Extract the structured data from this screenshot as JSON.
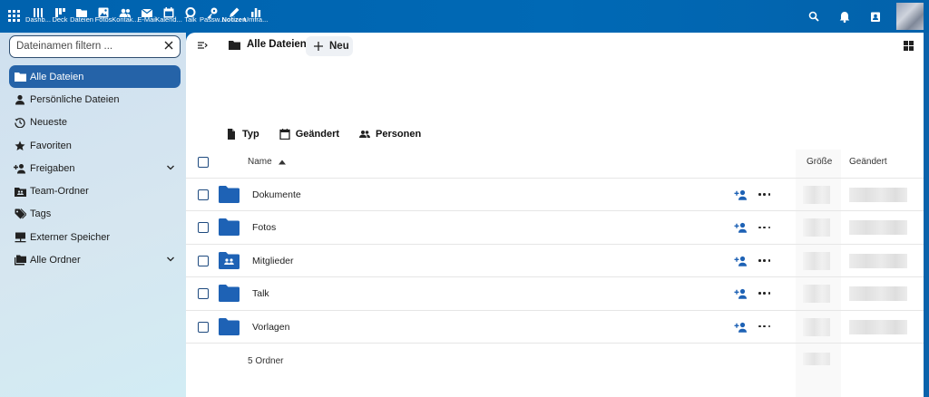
{
  "topbar": {
    "apps": [
      {
        "label": "Dashb...",
        "icon": "dashboard-icon"
      },
      {
        "label": "Deck",
        "icon": "deck-icon"
      },
      {
        "label": "Dateien",
        "icon": "folder-icon"
      },
      {
        "label": "Fotos",
        "icon": "photos-icon"
      },
      {
        "label": "Kontak...",
        "icon": "contacts-icon"
      },
      {
        "label": "E-Mail",
        "icon": "mail-icon"
      },
      {
        "label": "Kalend...",
        "icon": "calendar-icon"
      },
      {
        "label": "Talk",
        "icon": "talk-icon"
      },
      {
        "label": "Passw...",
        "icon": "key-icon"
      },
      {
        "label": "Notizen",
        "icon": "pencil-icon"
      },
      {
        "label": "Umfra...",
        "icon": "poll-icon"
      }
    ],
    "active_app": "Notizen"
  },
  "sidebar": {
    "filter_placeholder": "Dateinamen filtern ...",
    "items": [
      {
        "label": "Alle Dateien",
        "icon": "folder-icon",
        "active": true
      },
      {
        "label": "Persönliche Dateien",
        "icon": "person-icon"
      },
      {
        "label": "Neueste",
        "icon": "history-icon"
      },
      {
        "label": "Favoriten",
        "icon": "star-icon"
      },
      {
        "label": "Freigaben",
        "icon": "share-icon",
        "expandable": true
      },
      {
        "label": "Team-Ordner",
        "icon": "team-folder-icon"
      },
      {
        "label": "Tags",
        "icon": "tag-icon"
      },
      {
        "label": "Externer Speicher",
        "icon": "network-icon"
      },
      {
        "label": "Alle Ordner",
        "icon": "folders-icon",
        "expandable": true
      }
    ]
  },
  "main": {
    "breadcrumb": "Alle Dateien",
    "new_button": "Neu",
    "filters": [
      {
        "label": "Typ",
        "icon": "file-icon"
      },
      {
        "label": "Geändert",
        "icon": "calendar-icon"
      },
      {
        "label": "Personen",
        "icon": "people-icon"
      }
    ],
    "columns": {
      "name": "Name",
      "size": "Größe",
      "modified": "Geändert"
    },
    "rows": [
      {
        "name": "Dokumente",
        "type": "folder"
      },
      {
        "name": "Fotos",
        "type": "folder"
      },
      {
        "name": "Mitglieder",
        "type": "group-folder"
      },
      {
        "name": "Talk",
        "type": "folder"
      },
      {
        "name": "Vorlagen",
        "type": "folder"
      }
    ],
    "summary": "5 Ordner"
  },
  "colors": {
    "brand": "#0062ae",
    "active_nav": "#2563a8",
    "folder": "#1e62b5"
  }
}
